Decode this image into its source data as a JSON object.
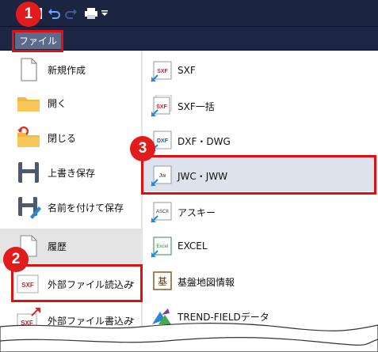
{
  "ribbon": {
    "file_tab_label": "ファイル"
  },
  "left_menu": {
    "items": [
      {
        "label": "新規作成",
        "icon": "new-document-icon"
      },
      {
        "label": "開く",
        "icon": "open-folder-icon"
      },
      {
        "label": "閉じる",
        "icon": "close-folder-icon"
      },
      {
        "label": "上書き保存",
        "icon": "save-icon"
      },
      {
        "label": "名前を付けて保存",
        "icon": "save-as-icon"
      },
      {
        "label": "履歴",
        "icon": "history-icon"
      },
      {
        "label": "外部ファイル読込み",
        "icon": "import-sxf-icon",
        "submenu_arrow": "▸"
      },
      {
        "label": "外部ファイル書込み",
        "icon": "export-sxf-icon",
        "submenu_arrow": "▸"
      }
    ]
  },
  "right_menu": {
    "items": [
      {
        "label": "SXF",
        "icon_text": "SXF"
      },
      {
        "label": "SXF一括",
        "icon_text": "SXF"
      },
      {
        "label": "DXF・DWG",
        "icon_text": "DXF"
      },
      {
        "label": "JWC・JWW",
        "icon_text": "Jw"
      },
      {
        "label": "アスキー",
        "icon_text": "ASCII"
      },
      {
        "label": "EXCEL",
        "icon_text": "Excel"
      },
      {
        "label": "基盤地図情報",
        "icon_text": "基"
      },
      {
        "label": "TREND-FIELDデータ",
        "icon_text": ""
      }
    ]
  },
  "callouts": {
    "step1": "1",
    "step2": "2",
    "step3": "3"
  },
  "colors": {
    "titlebar": "#1b2440",
    "file_tab": "#5c6b8c",
    "highlight_red": "#e01010",
    "import_arrow_blue": "#2a86d6",
    "export_arrow_red": "#d62a2a"
  }
}
